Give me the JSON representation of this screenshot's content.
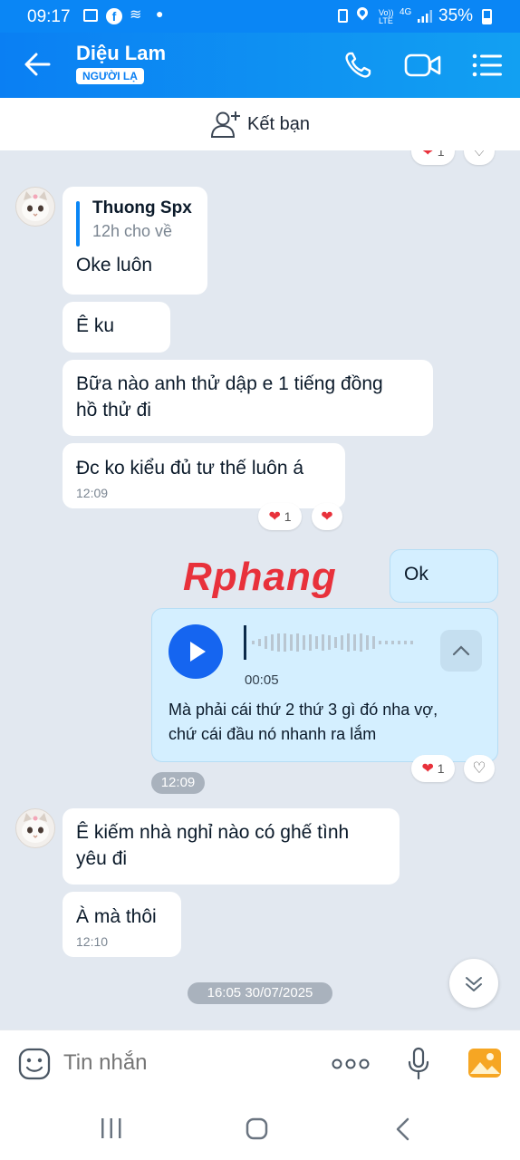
{
  "status": {
    "time": "09:17",
    "net": "Vo)) LTE",
    "net_type": "4G",
    "battery": "35%"
  },
  "header": {
    "name": "Diệu Lam",
    "badge": "NGƯỜI LẠ"
  },
  "add_friend": {
    "label": "Kết bạn"
  },
  "messages": {
    "m1": {
      "quote_author": "Thuong Spx",
      "quote_text": "12h cho về",
      "text": "Oke luôn"
    },
    "m2": {
      "text": "Ê ku"
    },
    "m3": {
      "line1": "Bữa nào anh thử dập e 1 tiếng đồng",
      "line2": "hồ thử đi"
    },
    "m4": {
      "text": "Đc ko kiểu đủ tư thế luôn á",
      "time": "12:09",
      "react_count": "1"
    },
    "m5": {
      "text": "Ok"
    },
    "voice": {
      "duration": "00:05",
      "line1": "Mà phải cái thứ 2 thứ 3 gì đó nha vợ,",
      "line2": "chứ cái đầu nó nhanh ra lắm",
      "react_count": "1"
    },
    "sep1": "12:09",
    "m6": {
      "line1": "Ê kiếm nhà nghỉ nào có ghế tình",
      "line2": "yêu đi"
    },
    "m7": {
      "text": "À mà thôi",
      "time": "12:10"
    },
    "sep2": "16:05 30/07/2025",
    "top_react_count": "1"
  },
  "watermark": "Rphang",
  "input": {
    "placeholder": "Tin nhắn"
  },
  "colors": {
    "brand": "#0a86f5",
    "heart": "#e8313b",
    "play": "#1565f0",
    "mine_bubble": "#d4efff"
  }
}
